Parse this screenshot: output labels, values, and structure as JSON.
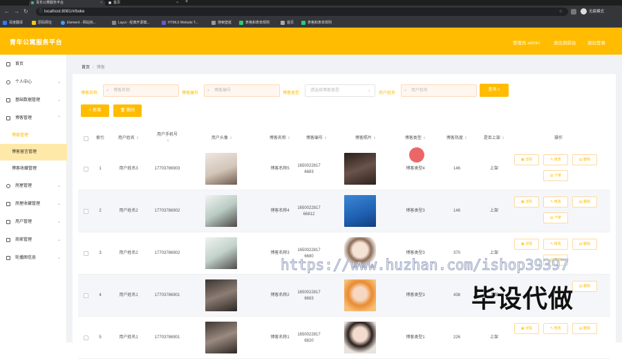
{
  "browser": {
    "tabs": [
      {
        "label": "青年公寓服务平台",
        "close": "×"
      },
      {
        "label": "首页",
        "close": "×"
      }
    ],
    "new_tab": "+",
    "url": "localhost:8081/#/boke",
    "profile": "无痕模式",
    "bookmarks": [
      "百度翻译",
      "原码网址",
      "Element - 网站快...",
      "Layui - 经典开源模...",
      "HTML5 Website T...",
      "搜索壁纸",
      "表格和表单规则",
      "首页",
      "表格和表单规则"
    ]
  },
  "header": {
    "title": "青年公寓服务平台",
    "user": "管理员 admin",
    "exit_admin": "退出到前台",
    "logout": "退出登录"
  },
  "sidebar": {
    "items": [
      {
        "label": "首页"
      },
      {
        "label": "个人中心"
      },
      {
        "label": "基础数据管理"
      },
      {
        "label": "博客管理"
      },
      {
        "label": "房屋管理"
      },
      {
        "label": "房屋收藏管理"
      },
      {
        "label": "用户管理"
      },
      {
        "label": "商家管理"
      },
      {
        "label": "轮播图信息"
      }
    ],
    "sub_items": [
      {
        "label": "博客管理"
      },
      {
        "label": "博客留言管理"
      },
      {
        "label": "博客收藏管理"
      }
    ]
  },
  "breadcrumb": {
    "home": "首页",
    "sep": "/",
    "current": "博客"
  },
  "filters": {
    "name_label": "博客名称",
    "name_placeholder": "博客名称",
    "code_label": "博客编号",
    "code_placeholder": "博客编号",
    "type_label": "博客类型",
    "type_placeholder": "请选择博客类型",
    "user_label": "用户姓名",
    "user_placeholder": "用户姓名",
    "query_button": "查询"
  },
  "actions": {
    "add": "新增",
    "delete": "删除"
  },
  "table": {
    "headers": {
      "index": "索引",
      "user_name": "用户姓名",
      "user_phone": "用户手机号",
      "user_avatar": "用户头像",
      "blog_name": "博客名称",
      "blog_code": "博客编号",
      "blog_photo": "博客照片",
      "blog_type": "博客类型",
      "blog_heat": "博客热度",
      "status": "是否上架",
      "ops": "操作"
    },
    "row_actions": {
      "detail": "详情",
      "edit": "修改",
      "delete": "删除",
      "off": "下架"
    },
    "rows": [
      {
        "index": "1",
        "user_name": "用户姓名3",
        "phone": "17703786903",
        "blog_name": "博客名称5",
        "code": "16500228176683",
        "type": "博客类型4",
        "heat": "146",
        "status": "上架",
        "avatar_color": "#d9cdc3",
        "photo_color": "#4a3b35"
      },
      {
        "index": "2",
        "user_name": "用户姓名2",
        "phone": "17703786902",
        "blog_name": "博客名称4",
        "code": "165002281766812",
        "type": "博客类型3",
        "heat": "148",
        "status": "上架",
        "avatar_color": "#c7d6cf",
        "photo_color": "#2a6fc9"
      },
      {
        "index": "3",
        "user_name": "用户姓名2",
        "phone": "17703786902",
        "blog_name": "博客名称3",
        "code": "16500228176680",
        "type": "博客类型3",
        "heat": "370",
        "status": "上架",
        "avatar_color": "#cfdad4",
        "photo_color": "#f3e6dc"
      },
      {
        "index": "4",
        "user_name": "用户姓名1",
        "phone": "17703786901",
        "blog_name": "博客名称2",
        "code": "16500228176683",
        "type": "博客类型3",
        "heat": "438",
        "status": "上架",
        "avatar_color": "#5e5550",
        "photo_color": "#f0a347"
      },
      {
        "index": "5",
        "user_name": "用户姓名1",
        "phone": "17703786901",
        "blog_name": "博客名称1",
        "code": "16500228176820",
        "type": "博客类型1",
        "heat": "226",
        "status": "上架",
        "avatar_color": "#6b5d55",
        "photo_color": "#e8ddd5"
      }
    ]
  },
  "watermark": {
    "url": "https://www.huzhan.com/ishop39397",
    "text": "毕设代做"
  },
  "colors": {
    "brand": "#ffbc00",
    "brand_light": "#ffe9a8"
  }
}
